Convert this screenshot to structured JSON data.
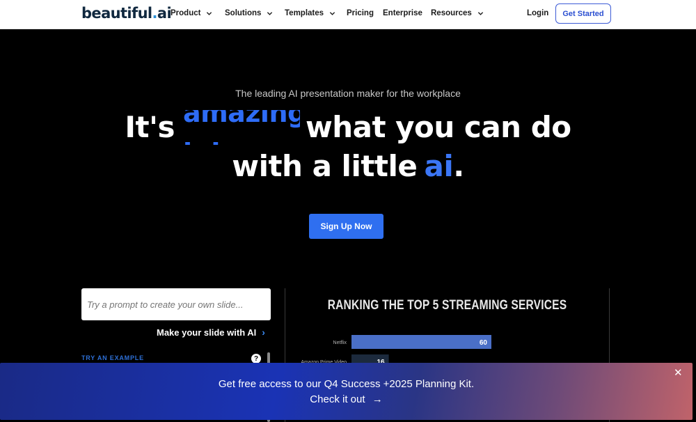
{
  "nav": {
    "logo_main": "beautiful",
    "logo_dot": ".",
    "logo_suffix": "ai",
    "items": [
      {
        "label": "Product",
        "has_dropdown": true
      },
      {
        "label": "Solutions",
        "has_dropdown": true
      },
      {
        "label": "Templates",
        "has_dropdown": true
      },
      {
        "label": "Pricing",
        "has_dropdown": false
      },
      {
        "label": "Enterprise",
        "has_dropdown": false
      },
      {
        "label": "Resources",
        "has_dropdown": true
      }
    ],
    "login": "Login",
    "get_started": "Get Started"
  },
  "hero": {
    "tagline": "The leading AI presentation maker for the workplace",
    "line1_prefix": "It's",
    "rotating_word": "amazing",
    "line1_suffix": "what you can do",
    "line2_prefix": "with a little",
    "line2_highlight": "ai",
    "line2_end": ".",
    "cta": "Sign Up Now"
  },
  "prompt_panel": {
    "placeholder": "Try a prompt to create your own slide...",
    "value": "",
    "make_slide": "Make your slide with AI",
    "make_slide_arrow": "›",
    "try_example": "TRY AN EXAMPLE",
    "help_icon": "?"
  },
  "colors": {
    "accent": "#2f6ff0",
    "bar_primary": "#4a6fc7",
    "bar_secondary": "#1c2a3d"
  },
  "chart_data": {
    "type": "bar",
    "orientation": "horizontal",
    "title": "RANKING THE TOP 5 STREAMING SERVICES",
    "categories": [
      "Netflix",
      "Amazon Prime Video"
    ],
    "values": [
      60,
      16
    ],
    "xlim": [
      0,
      100
    ],
    "grid": false,
    "note": "Only the first two bars are visible; remaining bars are hidden behind the banner."
  },
  "banner": {
    "text": "Get free access to our Q4 Success +2025 Planning Kit.",
    "link": "Check it out",
    "link_arrow": "→",
    "close": "✕"
  }
}
